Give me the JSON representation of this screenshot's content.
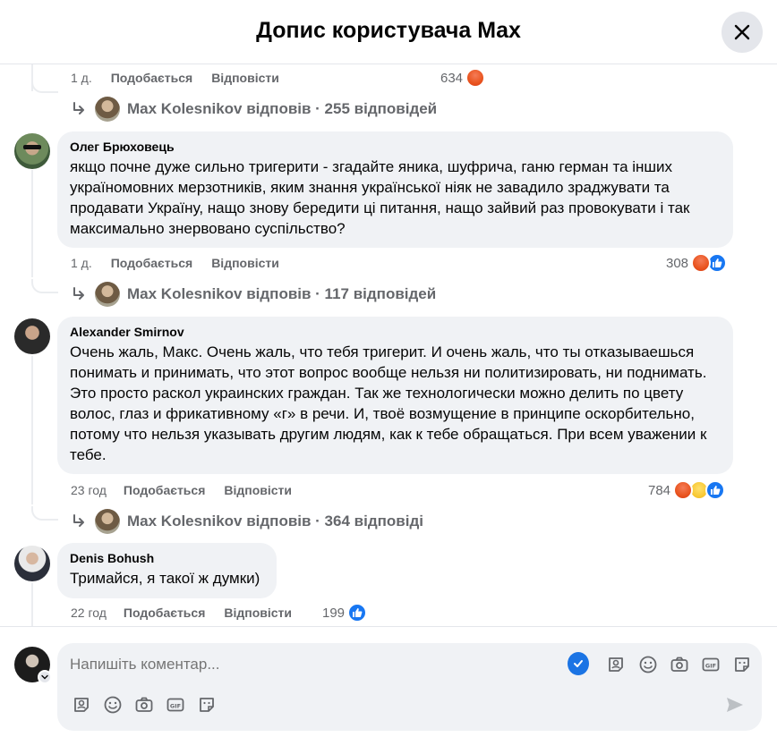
{
  "header": {
    "title": "Допис користувача Max"
  },
  "actions": {
    "like": "Подобається",
    "reply": "Відповісти"
  },
  "comment0": {
    "time": "1 д.",
    "reaction_count": "634",
    "replies": "Max Kolesnikov відповів · 255 відповідей"
  },
  "comments": [
    {
      "author": "Олег Брюховець",
      "text": "якщо почне дуже сильно тригерити - згадайте яника, шуфрича, ганю герман та інших україномовних мерзотників, яким знання української ніяк не завадило зраджувати та продавати Україну, нащо знову бередити ці питання, нащо зайвий раз провокувати і так максимально знервовано суспільство?",
      "time": "1 д.",
      "reaction_count": "308",
      "replies": "Max Kolesnikov відповів · 117 відповідей"
    },
    {
      "author": "Alexander Smirnov",
      "text": "Очень жаль, Макс. Очень жаль, что тебя тригерит. И очень жаль, что ты отказываешься понимать и принимать, что этот вопрос вообще нельзя ни политизировать, ни поднимать. Это просто раскол украинских граждан. Так же технологически можно делить по цвету волос, глаз и фрикативному «г» в речи. И, твоё возмущение в принципе оскорбительно, потому что нельзя указывать другим людям, как к тебе обращаться. При всем уважении к тебе.",
      "time": "23 год",
      "reaction_count": "784",
      "replies": "Max Kolesnikov відповів · 364 відповіді"
    },
    {
      "author": "Denis Bohush",
      "text": "Тримайся, я такої ж думки)",
      "time": "22 год",
      "reaction_count": "199"
    }
  ],
  "composer": {
    "placeholder": "Напишіть коментар..."
  },
  "colors": {
    "accent": "#1877f2",
    "bubble": "#f0f2f5",
    "muted": "#65676b"
  }
}
